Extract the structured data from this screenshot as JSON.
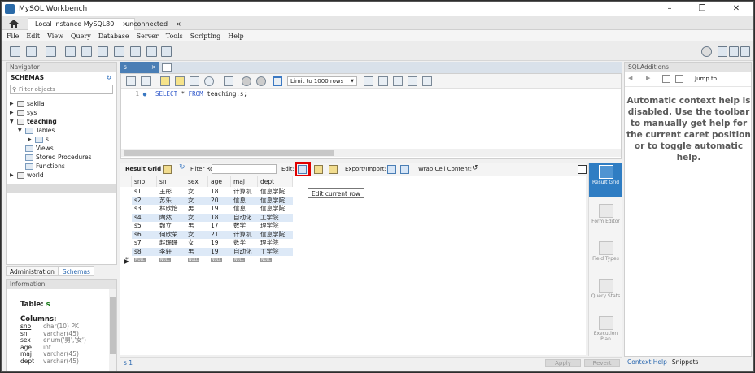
{
  "window": {
    "title": "MySQL Workbench",
    "minimize": "–",
    "maximize": "❐",
    "close": "✕"
  },
  "tabs": [
    {
      "label": "Local instance MySQL80",
      "close": "×"
    },
    {
      "label": "unconnected",
      "close": "×"
    }
  ],
  "menu": [
    "File",
    "Edit",
    "View",
    "Query",
    "Database",
    "Server",
    "Tools",
    "Scripting",
    "Help"
  ],
  "navigator": {
    "header": "Navigator",
    "schemas_title": "SCHEMAS",
    "filter_placeholder": "Filter objects",
    "tree": {
      "sakila": "sakila",
      "sys": "sys",
      "teaching": "teaching",
      "tables": "Tables",
      "s": "s",
      "views": "Views",
      "procs": "Stored Procedures",
      "funcs": "Functions",
      "world": "world"
    },
    "tabs": {
      "admin": "Administration",
      "schemas": "Schemas"
    }
  },
  "info": {
    "header": "Information",
    "table_label": "Table:",
    "table_name": "s",
    "columns_label": "Columns:",
    "columns": [
      {
        "name": "sno",
        "type": "char(10) PK"
      },
      {
        "name": "sn",
        "type": "varchar(45)"
      },
      {
        "name": "sex",
        "type": "enum('男','女')"
      },
      {
        "name": "age",
        "type": "int"
      },
      {
        "name": "maj",
        "type": "varchar(45)"
      },
      {
        "name": "dept",
        "type": "varchar(45)"
      }
    ]
  },
  "editor": {
    "tab": "s",
    "tab_close": "×",
    "limit": "Limit to 1000 rows",
    "line_no": "1",
    "sql_kw1": "SELECT",
    "sql_rest1": "*",
    "sql_kw2": "FROM",
    "sql_rest2": "teaching.s;"
  },
  "result": {
    "grid_label": "Result Grid",
    "filter_label": "Filter Rows:",
    "edit_label": "Edit:",
    "export_label": "Export/Import:",
    "wrap_label": "Wrap Cell Content:",
    "tooltip": "Edit current row",
    "columns": [
      "sno",
      "sn",
      "sex",
      "age",
      "maj",
      "dept"
    ],
    "rows": [
      [
        "s1",
        "王彤",
        "女",
        "18",
        "计算机",
        "信息学院"
      ],
      [
        "s2",
        "苏乐",
        "女",
        "20",
        "信息",
        "信息学院"
      ],
      [
        "s3",
        "林欣怡",
        "男",
        "19",
        "信息",
        "信息学院"
      ],
      [
        "s4",
        "陶然",
        "女",
        "18",
        "自动化",
        "工学院"
      ],
      [
        "s5",
        "魏立",
        "男",
        "17",
        "数学",
        "理学院"
      ],
      [
        "s6",
        "何欣荣",
        "女",
        "21",
        "计算机",
        "信息学院"
      ],
      [
        "s7",
        "赵珊珊",
        "女",
        "19",
        "数学",
        "理学院"
      ],
      [
        "s8",
        "李轩",
        "男",
        "19",
        "自动化",
        "工学院"
      ]
    ],
    "null_label": "NULL",
    "new_row_marker": "*",
    "current_row_marker": "▶",
    "side": {
      "result_grid": "Result Grid",
      "form_editor": "Form Editor",
      "field_types": "Field Types",
      "query_stats": "Query Stats",
      "execution_plan": "Execution Plan"
    }
  },
  "status": {
    "tab": "s 1",
    "apply": "Apply",
    "revert": "Revert"
  },
  "sqladditions": {
    "header": "SQLAdditions",
    "jump": "Jump to",
    "help": "Automatic context help is disabled. Use the toolbar to manually get help for the current caret position or to toggle automatic help.",
    "tabs": {
      "context": "Context Help",
      "snippets": "Snippets"
    }
  },
  "colors": {
    "accent": "#2f7dc3",
    "highlight": "#e00000",
    "row_band": "#dde9f7"
  }
}
